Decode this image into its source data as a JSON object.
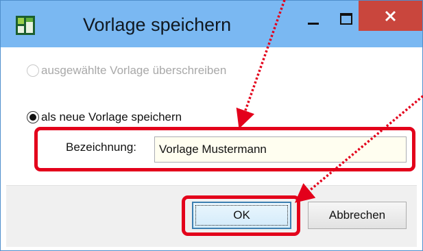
{
  "window": {
    "title": "Vorlage speichern"
  },
  "titlebar_buttons": {
    "minimize_icon": "minimize-icon",
    "maximize_icon": "maximize-icon",
    "close_icon": "close-icon"
  },
  "options": {
    "overwrite_label": "ausgewählte Vorlage überschreiben",
    "overwrite_enabled": false,
    "overwrite_checked": false,
    "save_new_label": "als neue Vorlage speichern",
    "save_new_checked": true
  },
  "name_field": {
    "label": "Bezeichnung:",
    "value": "Vorlage Mustermann"
  },
  "buttons": {
    "ok_label": "OK",
    "cancel_label": "Abbrechen"
  },
  "colors": {
    "titlebar": "#7ab8f2",
    "close_button": "#c9463d",
    "annotation": "#e3001b",
    "input_background": "#fffef0"
  }
}
